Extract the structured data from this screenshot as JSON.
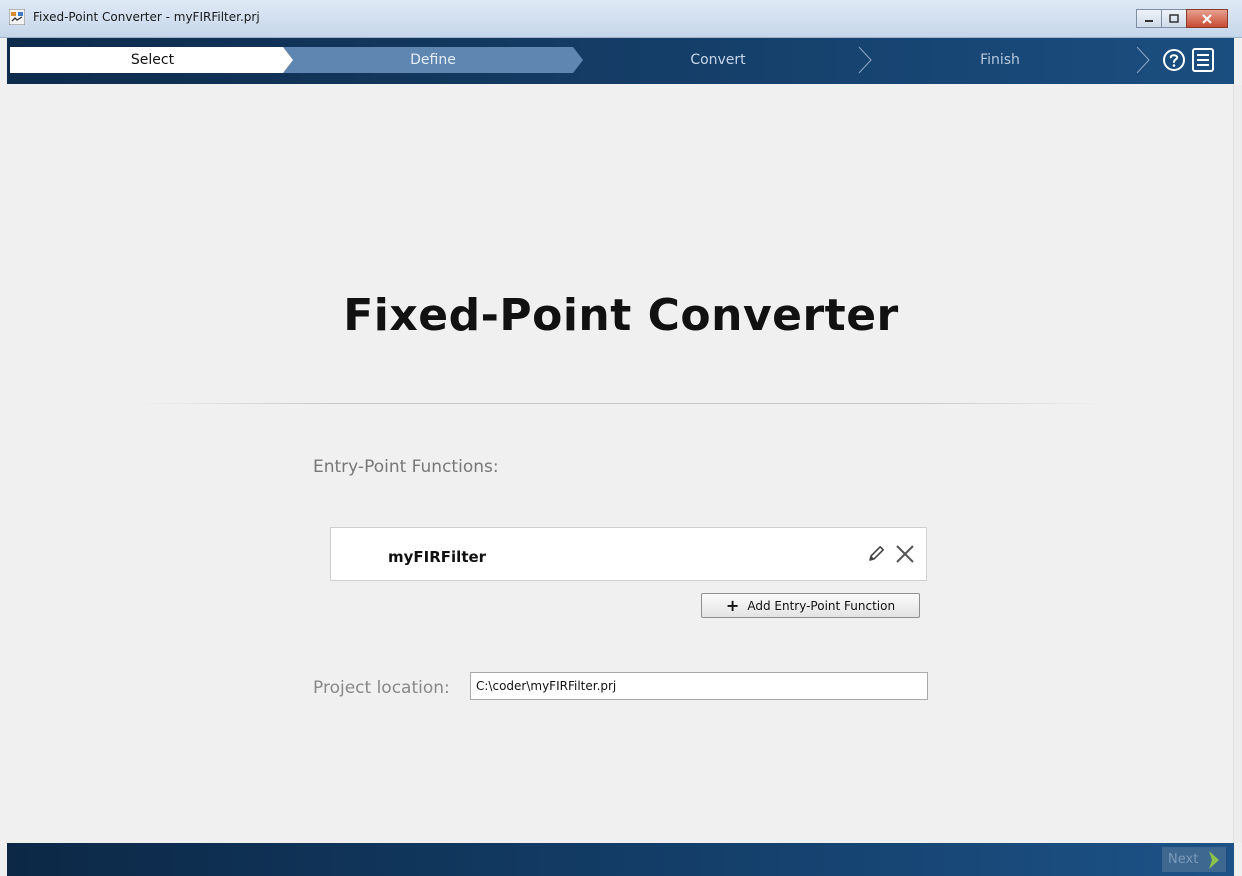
{
  "window": {
    "title": "Fixed-Point Converter - myFIRFilter.prj",
    "minimize_label": "▭",
    "maximize_label": "▣",
    "close_label": "✕"
  },
  "workflow": {
    "steps": [
      {
        "label": "Select",
        "state": "active"
      },
      {
        "label": "Define",
        "state": "next"
      },
      {
        "label": "Convert",
        "state": "inactive"
      },
      {
        "label": "Finish",
        "state": "inactive"
      }
    ],
    "help_icon": "help-icon",
    "menu_icon": "menu-icon"
  },
  "main": {
    "title": "Fixed-Point Converter",
    "entry_points_label": "Entry-Point Functions:",
    "entry_points": [
      {
        "name": "myFIRFilter"
      }
    ],
    "add_button_label": "Add Entry-Point Function",
    "project_location_label": "Project location:",
    "project_location_value": "C:\\coder\\myFIRFilter.prj"
  },
  "footer": {
    "next_label": "Next"
  },
  "colors": {
    "bar_dark": "#0e2b4c",
    "bar_light": "#1b4e80",
    "next_arrow": "#8bc34a"
  }
}
